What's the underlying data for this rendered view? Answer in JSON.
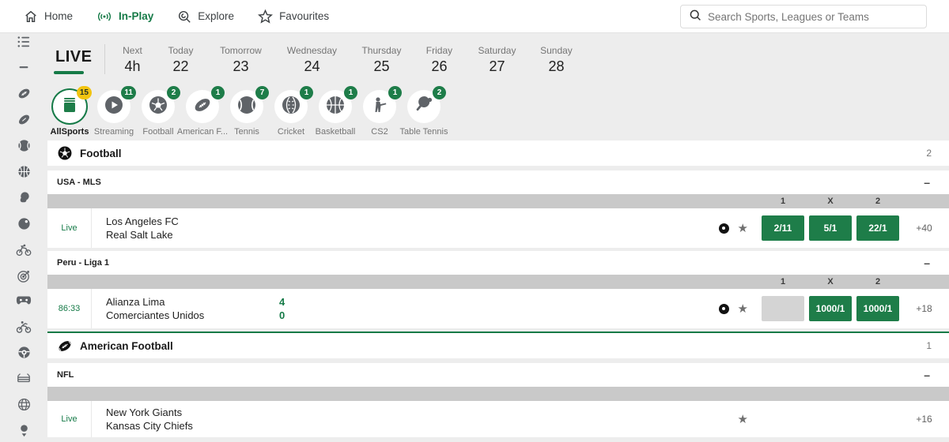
{
  "nav": {
    "items": [
      {
        "label": "Home",
        "icon": "home-icon"
      },
      {
        "label": "In-Play",
        "icon": "inplay-broadcast-icon",
        "active": true
      },
      {
        "label": "Explore",
        "icon": "explore-magnifier-icon"
      },
      {
        "label": "Favourites",
        "icon": "favourites-star-icon"
      }
    ],
    "search": {
      "placeholder": "Search Sports, Leagues or Teams",
      "icon": "search-icon"
    }
  },
  "sidebar_icons": [
    "menu-list-icon",
    "collapse-dash-icon",
    "american-football-icon",
    "rugby-icon",
    "tennis-icon",
    "basketball-icon",
    "boxing-icon",
    "bowls-icon",
    "cycling-icon",
    "darts-icon",
    "esports-icon",
    "motorcycling-icon",
    "steering-wheel-icon",
    "boxing-ring-icon",
    "internet-games-icon",
    "golf-icon"
  ],
  "date_tabs": {
    "live_label": "LIVE",
    "days": [
      {
        "label": "Next",
        "value": "4h"
      },
      {
        "label": "Today",
        "value": "22"
      },
      {
        "label": "Tomorrow",
        "value": "23"
      },
      {
        "label": "Wednesday",
        "value": "24"
      },
      {
        "label": "Thursday",
        "value": "25"
      },
      {
        "label": "Friday",
        "value": "26"
      },
      {
        "label": "Saturday",
        "value": "27"
      },
      {
        "label": "Sunday",
        "value": "28"
      }
    ]
  },
  "sport_chips": [
    {
      "label": "AllSports",
      "count": "15",
      "selected": true,
      "icon": "all-sports-icon"
    },
    {
      "label": "Streaming",
      "count": "11",
      "icon": "streaming-play-icon"
    },
    {
      "label": "Football",
      "count": "2",
      "icon": "football-icon"
    },
    {
      "label": "American F...",
      "count": "1",
      "icon": "american-football-icon"
    },
    {
      "label": "Tennis",
      "count": "7",
      "icon": "tennis-icon"
    },
    {
      "label": "Cricket",
      "count": "1",
      "icon": "cricket-icon"
    },
    {
      "label": "Basketball",
      "count": "1",
      "icon": "basketball-icon"
    },
    {
      "label": "CS2",
      "count": "1",
      "icon": "cs2-shooter-icon"
    },
    {
      "label": "Table Tennis",
      "count": "2",
      "icon": "table-tennis-icon"
    }
  ],
  "sections": [
    {
      "sport": "Football",
      "count": "2",
      "icon": "football-icon",
      "leagues": [
        {
          "name": "USA - MLS",
          "collapse": "–",
          "header": [
            "1",
            "X",
            "2"
          ],
          "matches": [
            {
              "status": "Live",
              "teams": [
                "Los Angeles FC",
                "Real Salt Lake"
              ],
              "has_stream": true,
              "odds": [
                "2/11",
                "5/1",
                "22/1"
              ],
              "more": "+40"
            }
          ]
        },
        {
          "name": "Peru - Liga 1",
          "collapse": "–",
          "header": [
            "1",
            "X",
            "2"
          ],
          "matches": [
            {
              "status": "86:33",
              "teams": [
                "Alianza Lima",
                "Comerciantes Unidos"
              ],
              "scores": [
                "4",
                "0"
              ],
              "has_stream": true,
              "odds": [
                "",
                "1000/1",
                "1000/1"
              ],
              "more": "+18"
            }
          ]
        }
      ]
    },
    {
      "sport": "American Football",
      "count": "1",
      "icon": "american-football-icon",
      "leagues": [
        {
          "name": "NFL",
          "collapse": "–",
          "header": [
            "",
            "",
            ""
          ],
          "matches": [
            {
              "status": "Live",
              "teams": [
                "New York Giants",
                "Kansas City Chiefs"
              ],
              "more": "+16"
            }
          ]
        }
      ]
    }
  ],
  "colors": {
    "accent_green": "#157a47",
    "odds_button_green": "#1e7d49",
    "selected_badge_yellow": "#f2c410",
    "odds_header_gray": "#c9c9c9",
    "page_background": "#ededed"
  }
}
